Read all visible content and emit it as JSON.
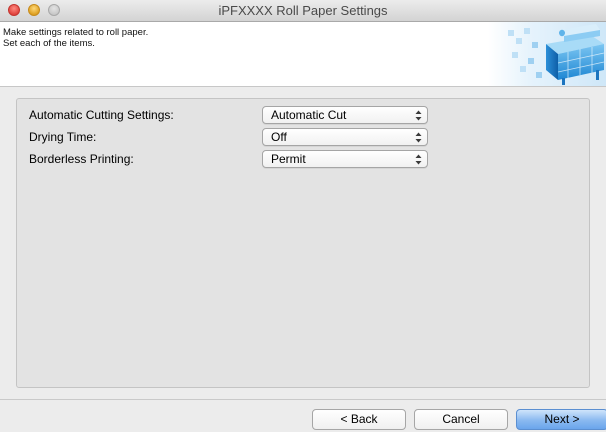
{
  "window": {
    "title": "iPFXXXX Roll Paper Settings"
  },
  "header": {
    "line1": "Make settings related to roll paper.",
    "line2": "Set each of the items.",
    "art_icon": "roll-paper-printer-icon"
  },
  "settings": [
    {
      "label": "Automatic Cutting Settings:",
      "value": "Automatic Cut"
    },
    {
      "label": "Drying Time:",
      "value": "Off"
    },
    {
      "label": "Borderless Printing:",
      "value": "Permit"
    }
  ],
  "buttons": {
    "back": "< Back",
    "cancel": "Cancel",
    "next": "Next >"
  },
  "colors": {
    "default_button": "#6aa5ec",
    "header_art": "#2a9be0"
  }
}
